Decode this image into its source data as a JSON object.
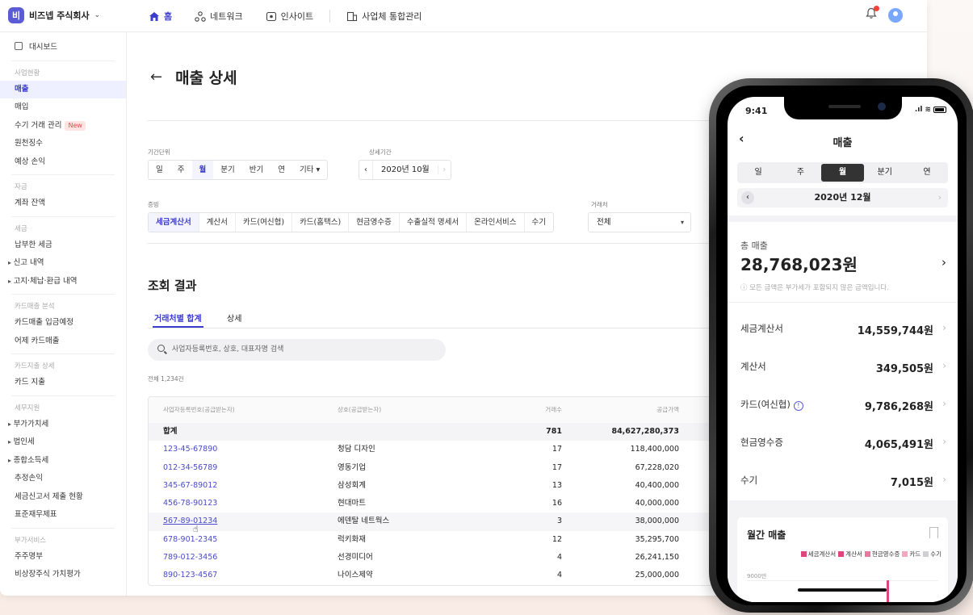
{
  "org": {
    "badge": "비",
    "name": "비즈넵 주식회사"
  },
  "topnav": [
    {
      "label": "홈",
      "icon": "home-icon"
    },
    {
      "label": "네트워크",
      "icon": "network-icon"
    },
    {
      "label": "인사이트",
      "icon": "insight-icon"
    },
    {
      "label": "사업체 통합관리",
      "icon": "building-icon"
    }
  ],
  "sidebar": {
    "dashboard": "대시보드",
    "group1": "사업현황",
    "items1": [
      "매출",
      "매입",
      "수기 거래 관리",
      "원천징수",
      "예상 손익"
    ],
    "new_badge": "New",
    "group2": "자금",
    "items2": [
      "계좌 잔액"
    ],
    "group3": "세금",
    "items3": [
      "납부한 세금"
    ],
    "sub3": [
      "신고 내역",
      "고지·체납·환급 내역"
    ],
    "group4": "카드매출 분석",
    "items4": [
      "카드매출 입금예정",
      "어제 카드매출"
    ],
    "group5": "카드지출 상세",
    "items5": [
      "카드 지출"
    ],
    "group6": "세무지원",
    "sub6": [
      "부가가치세",
      "법인세",
      "종합소득세"
    ],
    "items6": [
      "추정손익",
      "세금신고서 제출 현황",
      "표준재무제표"
    ],
    "group7": "부가서비스",
    "items7": [
      "주주명부",
      "비상장주식 가치평가"
    ]
  },
  "page": {
    "title": "매출 상세"
  },
  "filters": {
    "period_label": "기간단위",
    "period_options": [
      "일",
      "주",
      "월",
      "분기",
      "반기",
      "연",
      "기타 ▾"
    ],
    "period_selected": 2,
    "detail_label": "상세기간",
    "detail_value": "2020년 10월",
    "evidence_label": "증빙",
    "evidence_options": [
      "세금계산서",
      "계산서",
      "카드(여신협)",
      "카드(홈택스)",
      "현금영수증",
      "수출실적 명세서",
      "온라인서비스",
      "수기"
    ],
    "partner_label": "거래처",
    "partner_value": "전체"
  },
  "results": {
    "title": "조회 결과",
    "tabs": [
      "거래처별 합계",
      "상세"
    ],
    "search_placeholder": "사업자등록번호, 상호, 대표자명 검색",
    "count": "전체 1,234건",
    "columns": [
      "사업자등록번호(공급받는자)",
      "상호(공급받는자)",
      "거래수",
      "공급가액"
    ],
    "sum_row": [
      "합계",
      "",
      "781",
      "84,627,280,373"
    ],
    "rows": [
      [
        "123-45-67890",
        "청담 디자인",
        "17",
        "118,400,000"
      ],
      [
        "012-34-56789",
        "영동기업",
        "17",
        "67,228,020"
      ],
      [
        "345-67-89012",
        "삼성회계",
        "13",
        "40,400,000"
      ],
      [
        "456-78-90123",
        "현대마트",
        "16",
        "40,000,000"
      ],
      [
        "567-89-01234",
        "에덴탈 네트웍스",
        "3",
        "38,000,000"
      ],
      [
        "678-901-2345",
        "럭키화재",
        "12",
        "35,295,700"
      ],
      [
        "789-012-3456",
        "선경미디어",
        "4",
        "26,241,150"
      ],
      [
        "890-123-4567",
        "나이스제약",
        "4",
        "25,000,000"
      ]
    ]
  },
  "mobile": {
    "time": "9:41",
    "title": "매출",
    "segments": [
      "일",
      "주",
      "월",
      "분기",
      "연"
    ],
    "segment_selected": 2,
    "date": "2020년 12월",
    "total_label": "총 매출",
    "total_value": "28,768,023원",
    "note": "ⓘ 모든 금액은 부가세가 포함되지 않은 금액입니다.",
    "rows": [
      {
        "label": "세금계산서",
        "value": "14,559,744원"
      },
      {
        "label": "계산서",
        "value": "349,505원"
      },
      {
        "label": "카드(여신협)",
        "value": "9,786,268원"
      },
      {
        "label": "현금영수증",
        "value": "4,065,491원"
      },
      {
        "label": "수기",
        "value": "7,015원"
      }
    ],
    "card_title": "월간 매출",
    "legend": [
      {
        "name": "세금계산서",
        "color": "#e0457b"
      },
      {
        "name": "계산서",
        "color": "#e0457b"
      },
      {
        "name": "현금영수증",
        "color": "#e8799f"
      },
      {
        "name": "카드",
        "color": "#f1a8c0"
      },
      {
        "name": "수기",
        "color": "#cfcfd4"
      }
    ],
    "y_label": "9000만"
  }
}
